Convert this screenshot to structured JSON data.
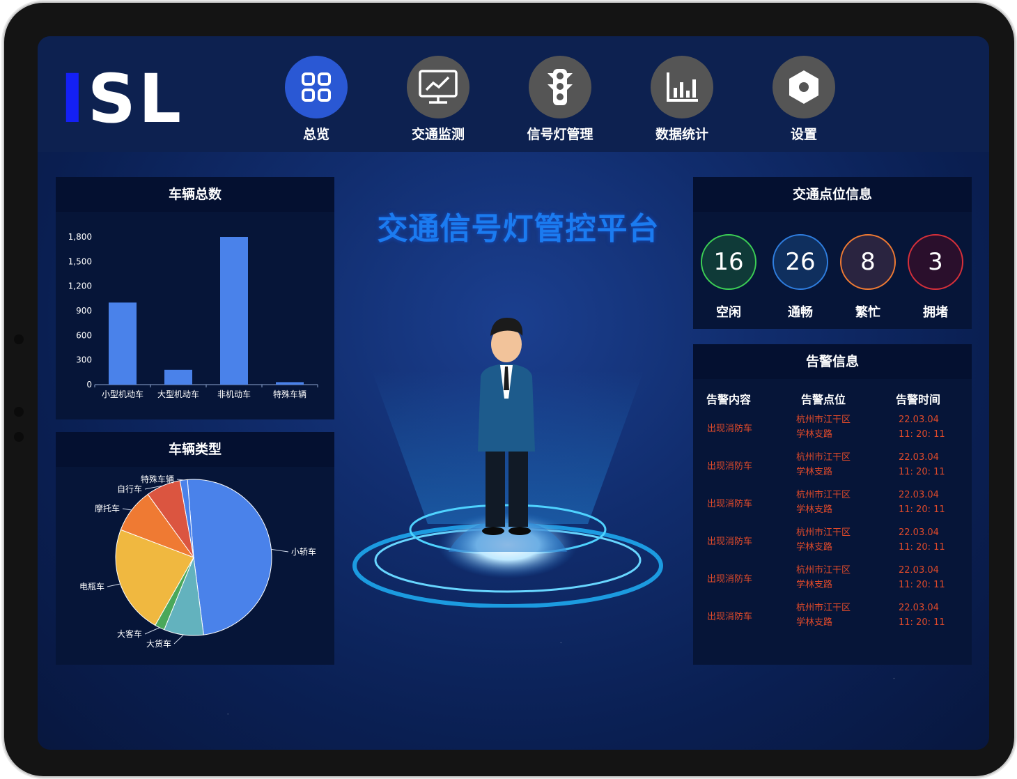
{
  "app": {
    "logo": {
      "part1": "I",
      "part2": "SL"
    }
  },
  "nav": [
    {
      "label": "总览",
      "icon": "grid-icon",
      "active": true
    },
    {
      "label": "交通监测",
      "icon": "monitor-chart-icon",
      "active": false
    },
    {
      "label": "信号灯管理",
      "icon": "traffic-light-icon",
      "active": false
    },
    {
      "label": "数据统计",
      "icon": "bar-chart-icon",
      "active": false
    },
    {
      "label": "设置",
      "icon": "settings-hexagon-icon",
      "active": false
    }
  ],
  "main": {
    "title": "交通信号灯管控平台"
  },
  "vehicle_total": {
    "title": "车辆总数",
    "chart_data": {
      "type": "bar",
      "categories": [
        "小型机动车",
        "大型机动车",
        "非机动车",
        "特殊车辆"
      ],
      "values": [
        1000,
        180,
        1800,
        30
      ],
      "ylim": [
        0,
        1800
      ],
      "yticks": [
        "0",
        "300",
        "600",
        "900",
        "1,200",
        "1,500",
        "1,800"
      ],
      "color": "#4a82ea"
    }
  },
  "vehicle_type": {
    "title": "车辆类型",
    "chart_data": {
      "type": "pie",
      "slices": [
        {
          "label": "小轿车",
          "value": 48,
          "color": "#4a82ea"
        },
        {
          "label": "大货车",
          "value": 8,
          "color": "#63b2be"
        },
        {
          "label": "大客车",
          "value": 2,
          "color": "#4aa85a"
        },
        {
          "label": "电瓶车",
          "value": 22,
          "color": "#f0b840"
        },
        {
          "label": "摩托车",
          "value": 9,
          "color": "#ef7a33"
        },
        {
          "label": "自行车",
          "value": 7,
          "color": "#db5540"
        },
        {
          "label": "特殊车辆",
          "value": 1.5,
          "color": "#4a82ea"
        }
      ]
    }
  },
  "traffic_points": {
    "title": "交通点位信息",
    "stats": [
      {
        "value": "16",
        "label": "空闲",
        "color": "#3ccf55",
        "fill": "#0f3a38"
      },
      {
        "value": "26",
        "label": "通畅",
        "color": "#2f7ee0",
        "fill": "#0f2f5e"
      },
      {
        "value": "8",
        "label": "繁忙",
        "color": "#ef7a33",
        "fill": "#2a2440"
      },
      {
        "value": "3",
        "label": "拥堵",
        "color": "#d8303a",
        "fill": "#2a0f2c"
      }
    ]
  },
  "alarm": {
    "title": "告警信息",
    "headers": [
      "告警内容",
      "告警点位",
      "告警时间"
    ],
    "rows": [
      {
        "content": "出现消防车",
        "loc1": "杭州市江干区",
        "loc2": "学林支路",
        "date": "22.03.04",
        "time": "11: 20: 11"
      },
      {
        "content": "出现消防车",
        "loc1": "杭州市江干区",
        "loc2": "学林支路",
        "date": "22.03.04",
        "time": "11: 20: 11"
      },
      {
        "content": "出现消防车",
        "loc1": "杭州市江干区",
        "loc2": "学林支路",
        "date": "22.03.04",
        "time": "11: 20: 11"
      },
      {
        "content": "出现消防车",
        "loc1": "杭州市江干区",
        "loc2": "学林支路",
        "date": "22.03.04",
        "time": "11: 20: 11"
      },
      {
        "content": "出现消防车",
        "loc1": "杭州市江干区",
        "loc2": "学林支路",
        "date": "22.03.04",
        "time": "11: 20: 11"
      },
      {
        "content": "出现消防车",
        "loc1": "杭州市江干区",
        "loc2": "学林支路",
        "date": "22.03.04",
        "time": "11: 20: 11"
      }
    ]
  }
}
